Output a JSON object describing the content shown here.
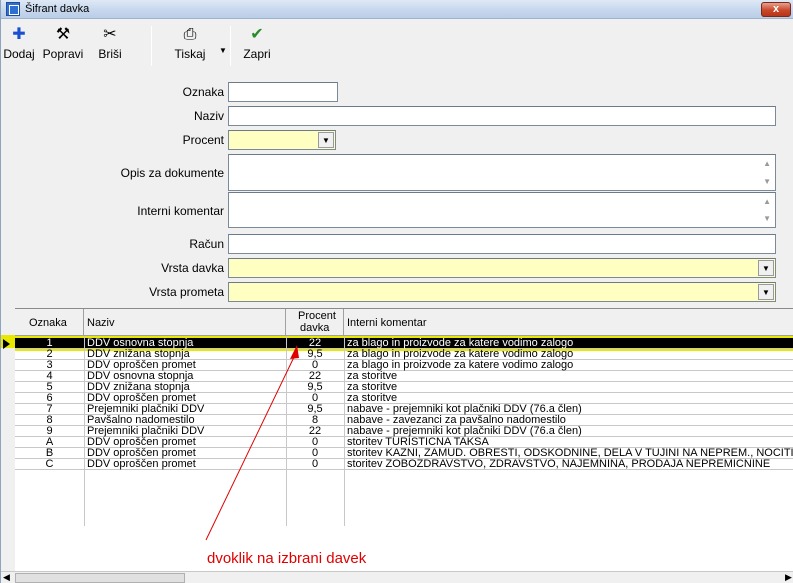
{
  "window": {
    "title": "Šifrant davka",
    "close_label": "x"
  },
  "toolbar": {
    "buttons": [
      {
        "label": "Dodaj",
        "icon": "plus-icon",
        "glyph": "✚",
        "color": "#1a4fd0"
      },
      {
        "label": "Popravi",
        "icon": "hammer-icon",
        "glyph": "⚒",
        "color": "#000000"
      },
      {
        "label": "Briši",
        "icon": "scissors-icon",
        "glyph": "✂",
        "color": "#000000"
      },
      {
        "label": "Tiskaj",
        "icon": "printer-icon",
        "glyph": "⎙",
        "color": "#000000"
      },
      {
        "label": "Zapri",
        "icon": "checkmark-icon",
        "glyph": "✔",
        "color": "#2a8a2a"
      }
    ],
    "dropdown_glyph": "▼"
  },
  "form": {
    "oznaka": {
      "label": "Oznaka",
      "value": ""
    },
    "naziv": {
      "label": "Naziv",
      "value": ""
    },
    "procent": {
      "label": "Procent",
      "value": ""
    },
    "opis": {
      "label": "Opis za dokumente",
      "value": ""
    },
    "interni": {
      "label": "Interni komentar",
      "value": ""
    },
    "racun": {
      "label": "Račun",
      "value": ""
    },
    "vrsta_davka": {
      "label": "Vrsta davka",
      "value": ""
    },
    "vrsta_prometa": {
      "label": "Vrsta prometa",
      "value": ""
    }
  },
  "grid": {
    "columns": {
      "oznaka": "Oznaka",
      "naziv": "Naziv",
      "procent_l1": "Procent",
      "procent_l2": "davka",
      "komentar": "Interni komentar"
    },
    "selected_row": 0,
    "rows": [
      {
        "oznaka": "1",
        "naziv": "DDV osnovna stopnja",
        "procent": "22",
        "komentar": "za blago in proizvode za katere vodimo zalogo"
      },
      {
        "oznaka": "2",
        "naziv": "DDV znižana stopnja",
        "procent": "9,5",
        "komentar": "za blago in proizvode za katere vodimo zalogo"
      },
      {
        "oznaka": "3",
        "naziv": "DDV oproščen promet",
        "procent": "0",
        "komentar": "za blago in proizvode za katere vodimo zalogo"
      },
      {
        "oznaka": "4",
        "naziv": "DDV osnovna stopnja",
        "procent": "22",
        "komentar": "za storitve"
      },
      {
        "oznaka": "5",
        "naziv": "DDV znižana stopnja",
        "procent": "9,5",
        "komentar": "za storitve"
      },
      {
        "oznaka": "6",
        "naziv": "DDV oproščen promet",
        "procent": "0",
        "komentar": "za storitve"
      },
      {
        "oznaka": "7",
        "naziv": "Prejemniki plačniki DDV",
        "procent": "9,5",
        "komentar": "nabave - prejemniki kot plačniki DDV (76.a člen)"
      },
      {
        "oznaka": "8",
        "naziv": "Pavšalno nadomestilo",
        "procent": "8",
        "komentar": "nabave - zavezanci za pavšalno nadomestilo"
      },
      {
        "oznaka": "9",
        "naziv": "Prejemniki plačniki DDV",
        "procent": "22",
        "komentar": "nabave - prejemniki kot plačniki DDV (76.a člen)"
      },
      {
        "oznaka": "A",
        "naziv": "DDV oproščen promet",
        "procent": "0",
        "komentar": "storitev TURISTIČNA TAKSA"
      },
      {
        "oznaka": "B",
        "naziv": "DDV oproščen promet",
        "procent": "0",
        "komentar": "storitev KAZNI, ZAMUD. OBRESTI, ODŠKODNINE, DELA V TUJINI NA NEPREM., NOČITI"
      },
      {
        "oznaka": "C",
        "naziv": "DDV oproščen promet",
        "procent": "0",
        "komentar": "storitev ZOBOZDRAVSTVO, ZDRAVSTVO, NAJEMNINA, PRODAJA NEPREMIČNINE"
      }
    ]
  },
  "annotation": {
    "text": "dvoklik na izbrani davek",
    "color": "#e00000"
  }
}
